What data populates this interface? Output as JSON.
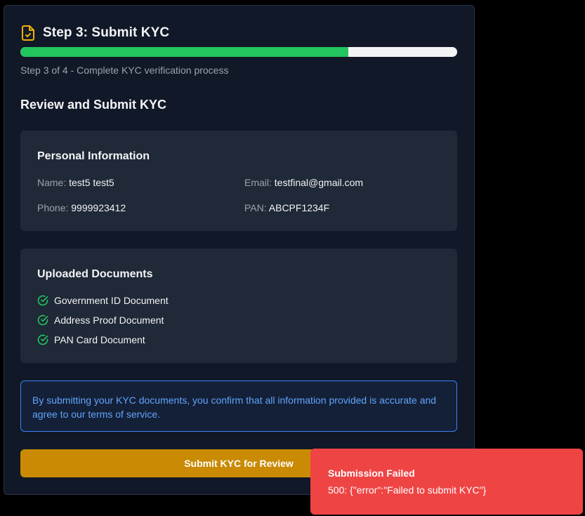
{
  "header": {
    "title": "Step 3: Submit KYC",
    "icon": "file-check-icon",
    "icon_color": "#eab308"
  },
  "progress": {
    "percent": 75,
    "fill_color": "#22c55e",
    "track_color": "#f3f4f6",
    "step_text": "Step 3 of 4 - Complete KYC verification process"
  },
  "review": {
    "title": "Review and Submit KYC"
  },
  "personal": {
    "title": "Personal Information",
    "fields": [
      {
        "label": "Name:",
        "value": "test5 test5"
      },
      {
        "label": "Email:",
        "value": "testfinal@gmail.com"
      },
      {
        "label": "Phone:",
        "value": "9999923412"
      },
      {
        "label": "PAN:",
        "value": "ABCPF1234F"
      }
    ]
  },
  "documents": {
    "title": "Uploaded Documents",
    "check_icon": "check-circle-icon",
    "check_color": "#22c55e",
    "items": [
      {
        "label": "Government ID Document"
      },
      {
        "label": "Address Proof Document"
      },
      {
        "label": "PAN Card Document"
      }
    ]
  },
  "notice": {
    "text": "By submitting your KYC documents, you confirm that all information provided is accurate and agree to our terms of service."
  },
  "submit": {
    "label": "Submit KYC for Review",
    "color": "#ca8a04"
  },
  "toast": {
    "title": "Submission Failed",
    "message": "500: {\"error\":\"Failed to submit KYC\"}",
    "color": "#ef4444"
  }
}
